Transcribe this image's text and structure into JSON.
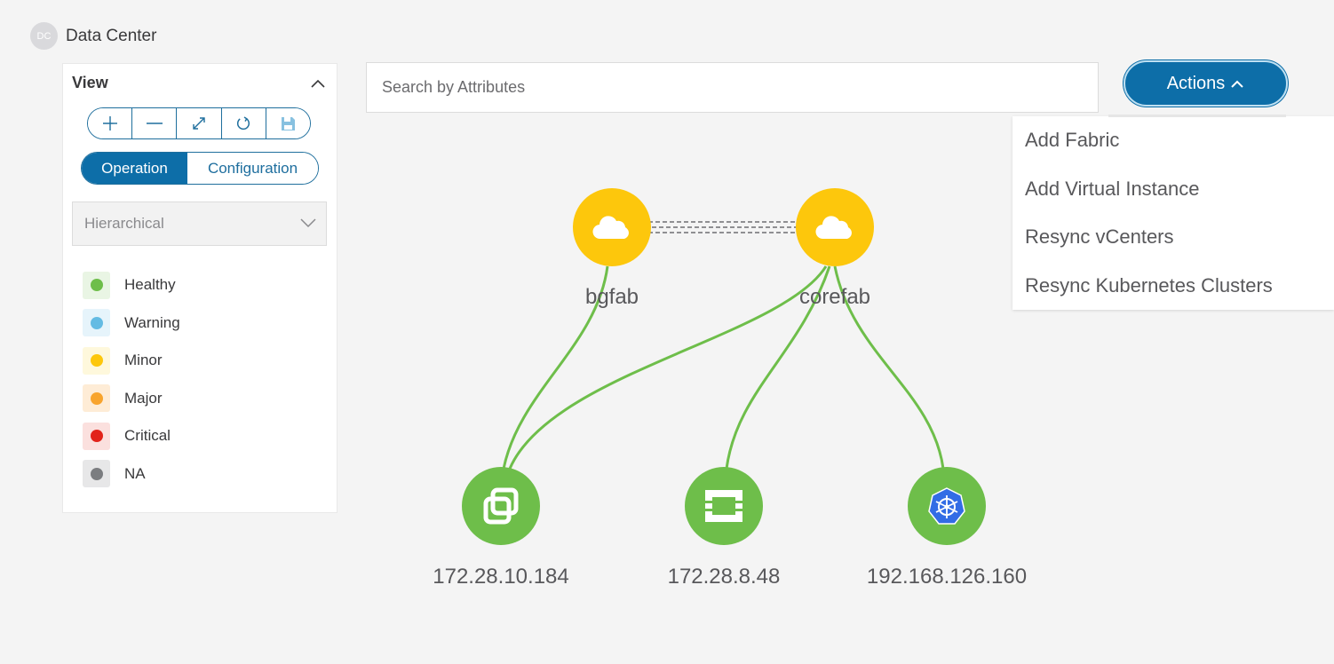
{
  "breadcrumb": {
    "badge": "DC",
    "title": "Data Center"
  },
  "view_panel": {
    "title": "View",
    "zoom_controls": [
      "zoom-in",
      "zoom-out",
      "fit-to-screen",
      "refresh",
      "save"
    ],
    "mode": {
      "options": [
        "Operation",
        "Configuration"
      ],
      "selected": "Operation"
    },
    "layout_select": {
      "value": "Hierarchical"
    },
    "legend": [
      {
        "label": "Healthy",
        "color": "#6ebe4a",
        "bg": "#e9f5e4"
      },
      {
        "label": "Warning",
        "color": "#64bbe3",
        "bg": "#e6f4fb"
      },
      {
        "label": "Minor",
        "color": "#fdc70c",
        "bg": "#fef8dc"
      },
      {
        "label": "Major",
        "color": "#f8a42d",
        "bg": "#feecd6"
      },
      {
        "label": "Critical",
        "color": "#e2231a",
        "bg": "#fbe0de"
      },
      {
        "label": "NA",
        "color": "#7b7d80",
        "bg": "#e7e7e8"
      }
    ]
  },
  "search": {
    "placeholder": "Search by Attributes",
    "value": ""
  },
  "actions": {
    "label": "Actions",
    "expanded": true,
    "menu": [
      "Add Fabric",
      "Add Virtual Instance",
      "Resync vCenters",
      "Resync Kubernetes Clusters"
    ]
  },
  "topology": {
    "fabrics": [
      {
        "name": "bgfab",
        "status": "Minor",
        "icon": "cloud-icon"
      },
      {
        "name": "corefab",
        "status": "Minor",
        "icon": "cloud-icon"
      }
    ],
    "hosts": [
      {
        "name": "172.28.10.184",
        "status": "Healthy",
        "icon": "vmware-icon"
      },
      {
        "name": "172.28.8.48",
        "status": "Healthy",
        "icon": "openstack-icon"
      },
      {
        "name": "192.168.126.160",
        "status": "Healthy",
        "icon": "kubernetes-icon"
      }
    ],
    "colors": {
      "fabric": "#fdc70c",
      "host": "#6ebe4a",
      "link": "#6ebe4a",
      "accent": "#0d6ea8"
    }
  }
}
